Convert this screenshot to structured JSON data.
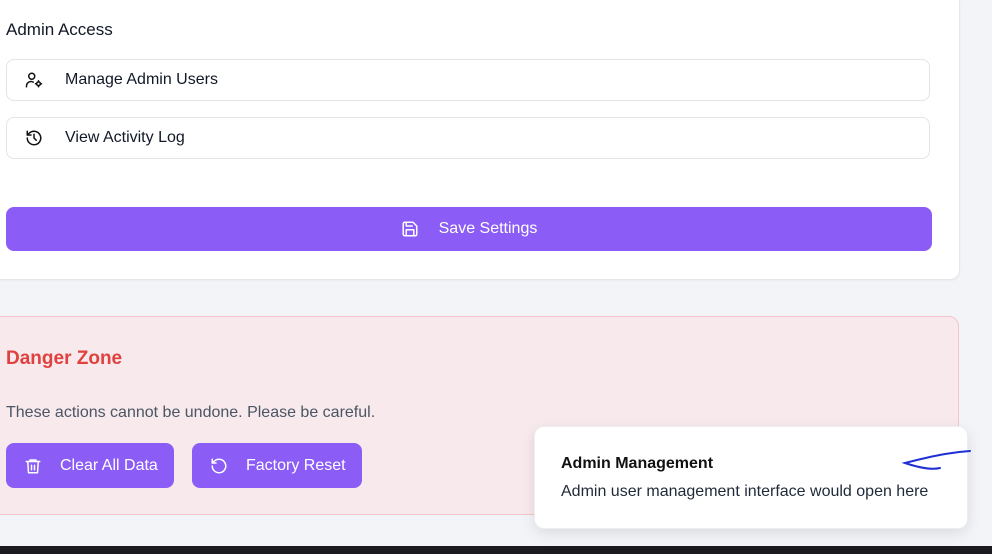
{
  "admin_access": {
    "title": "Admin Access",
    "items": [
      {
        "label": "Manage Admin Users",
        "icon": "user-gear-icon"
      },
      {
        "label": "View Activity Log",
        "icon": "history-icon"
      }
    ]
  },
  "save": {
    "label": "Save Settings",
    "icon": "save-icon"
  },
  "danger_zone": {
    "title": "Danger Zone",
    "description": "These actions cannot be undone. Please be careful.",
    "buttons": [
      {
        "label": "Clear All Data",
        "icon": "trash-icon"
      },
      {
        "label": "Factory Reset",
        "icon": "reset-icon"
      }
    ]
  },
  "toast": {
    "title": "Admin Management",
    "message": "Admin user management interface would open here"
  },
  "colors": {
    "accent": "#8b5cf6",
    "danger": "#e0413f",
    "danger_bg": "#f7e9ec",
    "annotation": "#1f2fd6"
  }
}
